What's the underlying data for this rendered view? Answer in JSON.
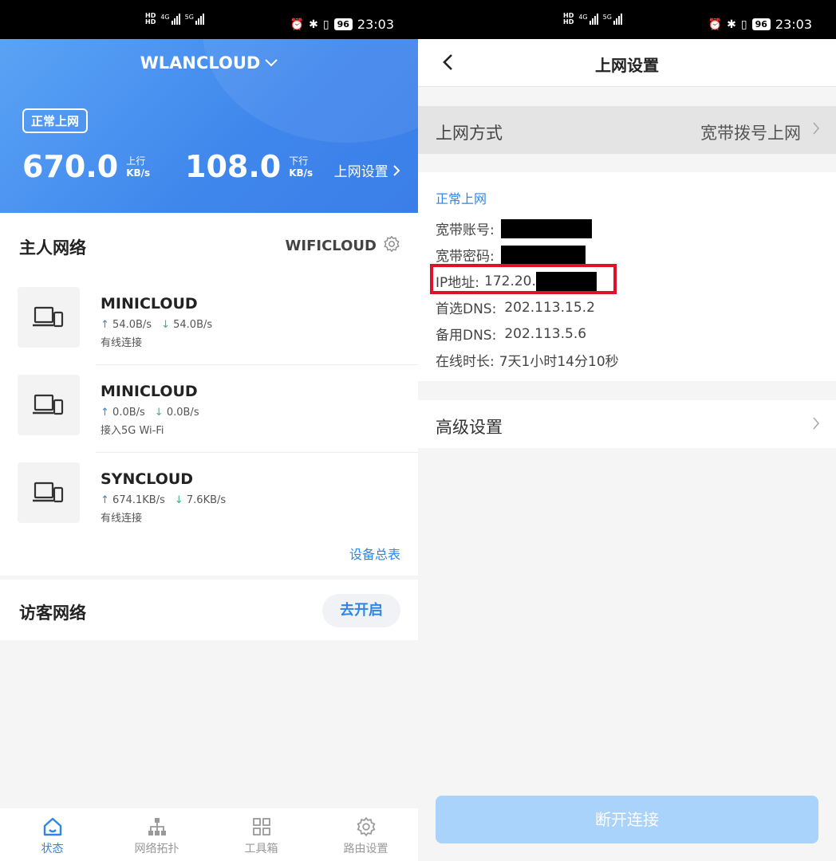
{
  "status_bar": {
    "time": "23:03",
    "battery": "96",
    "net_type_1": "4G",
    "net_type_2": "5G"
  },
  "colors": {
    "accent": "#2f86e6",
    "header_gradient_start": "#5aa3f5",
    "header_gradient_end": "#3b7ee8",
    "highlight_box": "#e0102a",
    "disconnect_button": "#a9d3fa"
  },
  "left": {
    "header": {
      "network_name": "WLANCLOUD",
      "status_badge": "正常上网",
      "upload_speed": "670.0",
      "upload_dir": "上行",
      "upload_unit": "KB/s",
      "download_speed": "108.0",
      "download_dir": "下行",
      "download_unit": "KB/s",
      "settings_link": "上网设置"
    },
    "main_network": {
      "title": "主人网络",
      "ssid": "WIFICLOUD",
      "devices": [
        {
          "name": "MINICLOUD",
          "up": "54.0B/s",
          "down": "54.0B/s",
          "connection": "有线连接"
        },
        {
          "name": "MINICLOUD",
          "up": "0.0B/s",
          "down": "0.0B/s",
          "connection": "接入5G Wi-Fi"
        },
        {
          "name": "SYNCLOUD",
          "up": "674.1KB/s",
          "down": "7.6KB/s",
          "connection": "有线连接"
        }
      ],
      "device_total_link": "设备总表"
    },
    "guest_network": {
      "title": "访客网络",
      "enable_button": "去开启"
    },
    "bottom_nav": [
      {
        "label": "状态",
        "icon": "home-icon",
        "active": true
      },
      {
        "label": "网络拓扑",
        "icon": "topology-icon",
        "active": false
      },
      {
        "label": "工具箱",
        "icon": "toolbox-icon",
        "active": false
      },
      {
        "label": "路由设置",
        "icon": "gear-icon",
        "active": false
      }
    ]
  },
  "right": {
    "title": "上网设置",
    "method": {
      "label": "上网方式",
      "value": "宽带拨号上网"
    },
    "info": {
      "status": "正常上网",
      "account_label": "宽带账号:",
      "password_label": "宽带密码:",
      "ip_label": "IP地址:",
      "ip_value": "172.20.",
      "dns1_label": "首选DNS:",
      "dns1_value": "202.113.15.2",
      "dns2_label": "备用DNS:",
      "dns2_value": "202.113.5.6",
      "uptime_label": "在线时长:",
      "uptime_value": "7天1小时14分10秒"
    },
    "advanced": {
      "label": "高级设置"
    },
    "disconnect_button": "断开连接"
  }
}
